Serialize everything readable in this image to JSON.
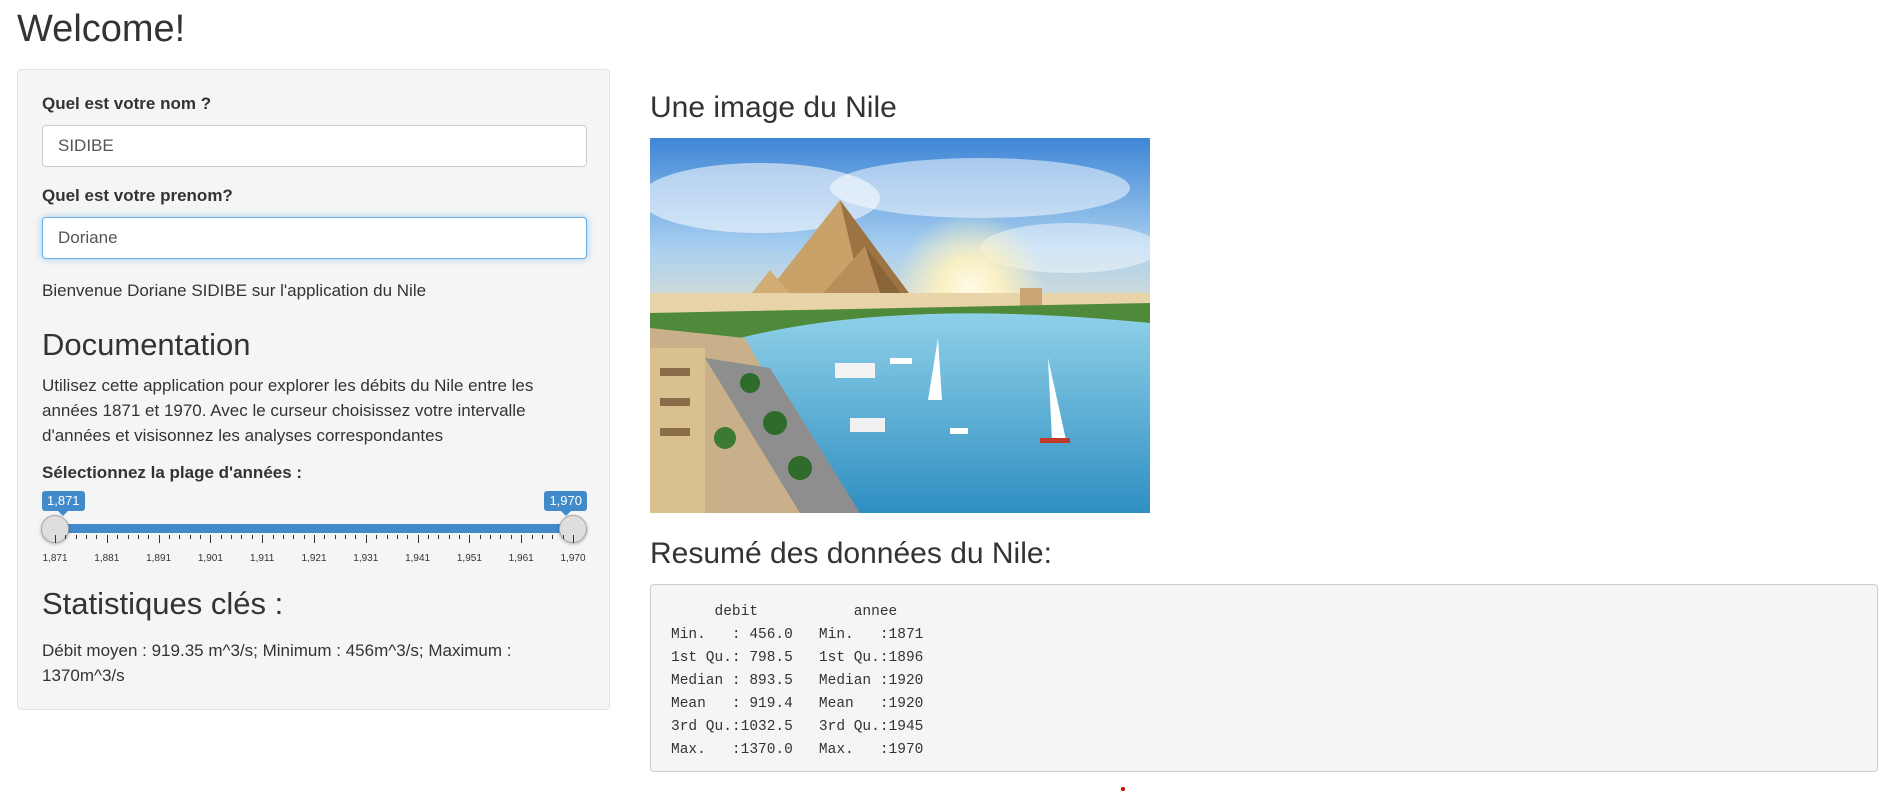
{
  "page": {
    "title": "Welcome!"
  },
  "sidebar": {
    "name_label": "Quel est votre nom ?",
    "name_value": "SIDIBE",
    "firstname_label": "Quel est votre prenom?",
    "firstname_value": "Doriane",
    "welcome_text": "Bienvenue Doriane SIDIBE sur l'application du Nile",
    "doc_title": "Documentation",
    "doc_text_lines": [
      "Utilisez cette application pour explorer les débits du Nile entre les",
      "années 1871 et 1970. Avec le curseur choisissez votre intervalle",
      "d'années et visisonnez les analyses correspondantes"
    ],
    "slider": {
      "label": "Sélectionnez la plage d'années :",
      "min": 1871,
      "max": 1970,
      "from": 1871,
      "to": 1970,
      "from_label": "1,871",
      "to_label": "1,970",
      "tick_labels": [
        "1,871",
        "1,881",
        "1,891",
        "1,901",
        "1,911",
        "1,921",
        "1,931",
        "1,941",
        "1,951",
        "1,961",
        "1,970"
      ],
      "accent": "#428bca"
    },
    "stats_title": "Statistiques clés :",
    "stats_lines": [
      "Débit moyen : 919.35 m^3/s; Minimum : 456m^3/s; Maximum :",
      "1370m^3/s"
    ]
  },
  "main": {
    "image_title": "Une image du Nile",
    "summary_title": "Resumé des données du Nile:",
    "summary_lines": [
      "     debit           annee     ",
      "Min.   : 456.0   Min.   :1871  ",
      "1st Qu.: 798.5   1st Qu.:1896  ",
      "Median : 893.5   Median :1920  ",
      "Mean   : 919.4   Mean   :1920  ",
      "3rd Qu.:1032.5   3rd Qu.:1945  ",
      "Max.   :1370.0   Max.   :1970  "
    ]
  }
}
